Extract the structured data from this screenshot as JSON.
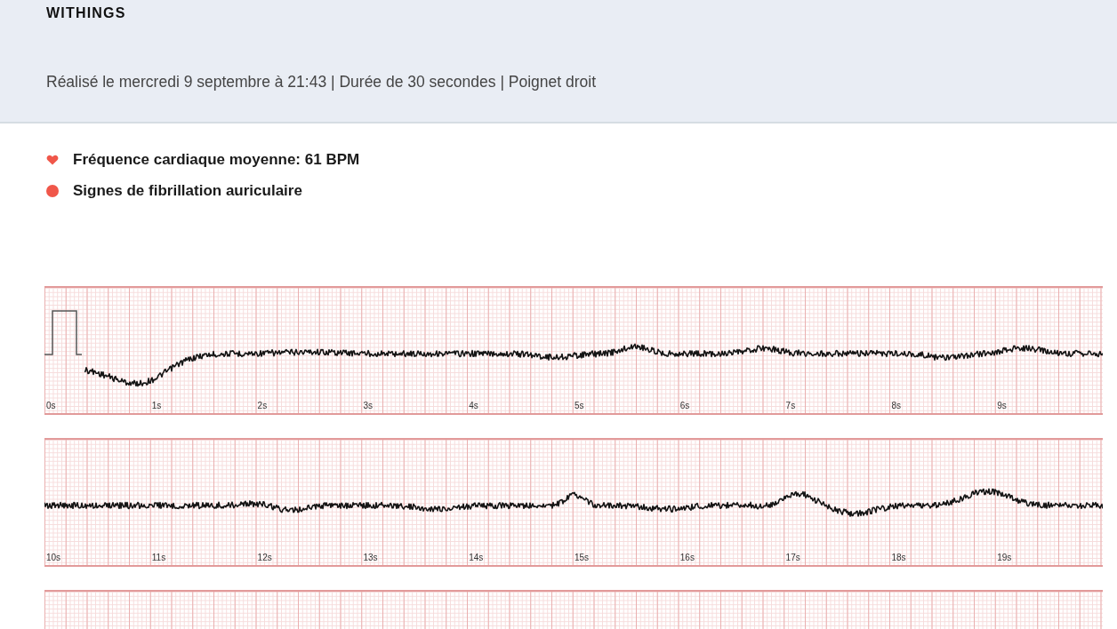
{
  "header": {
    "brand": "WITHINGS",
    "subtitle": "Réalisé le mercredi 9 septembre à 21:43 | Durée de 30 secondes | Poignet droit"
  },
  "findings": [
    {
      "kind": "heart",
      "text": "Fréquence cardiaque moyenne: 61 BPM"
    },
    {
      "kind": "dot",
      "text": "Signes de fibrillation auriculaire"
    }
  ],
  "ecg_strips": [
    {
      "calibration": true,
      "cut_off": false,
      "time_labels": [
        "0s",
        "1s",
        "2s",
        "3s",
        "4s",
        "5s",
        "6s",
        "7s",
        "8s",
        "9s"
      ]
    },
    {
      "calibration": false,
      "cut_off": false,
      "time_labels": [
        "10s",
        "11s",
        "12s",
        "13s",
        "14s",
        "15s",
        "16s",
        "17s",
        "18s",
        "19s"
      ]
    },
    {
      "calibration": false,
      "cut_off": true
    }
  ]
}
